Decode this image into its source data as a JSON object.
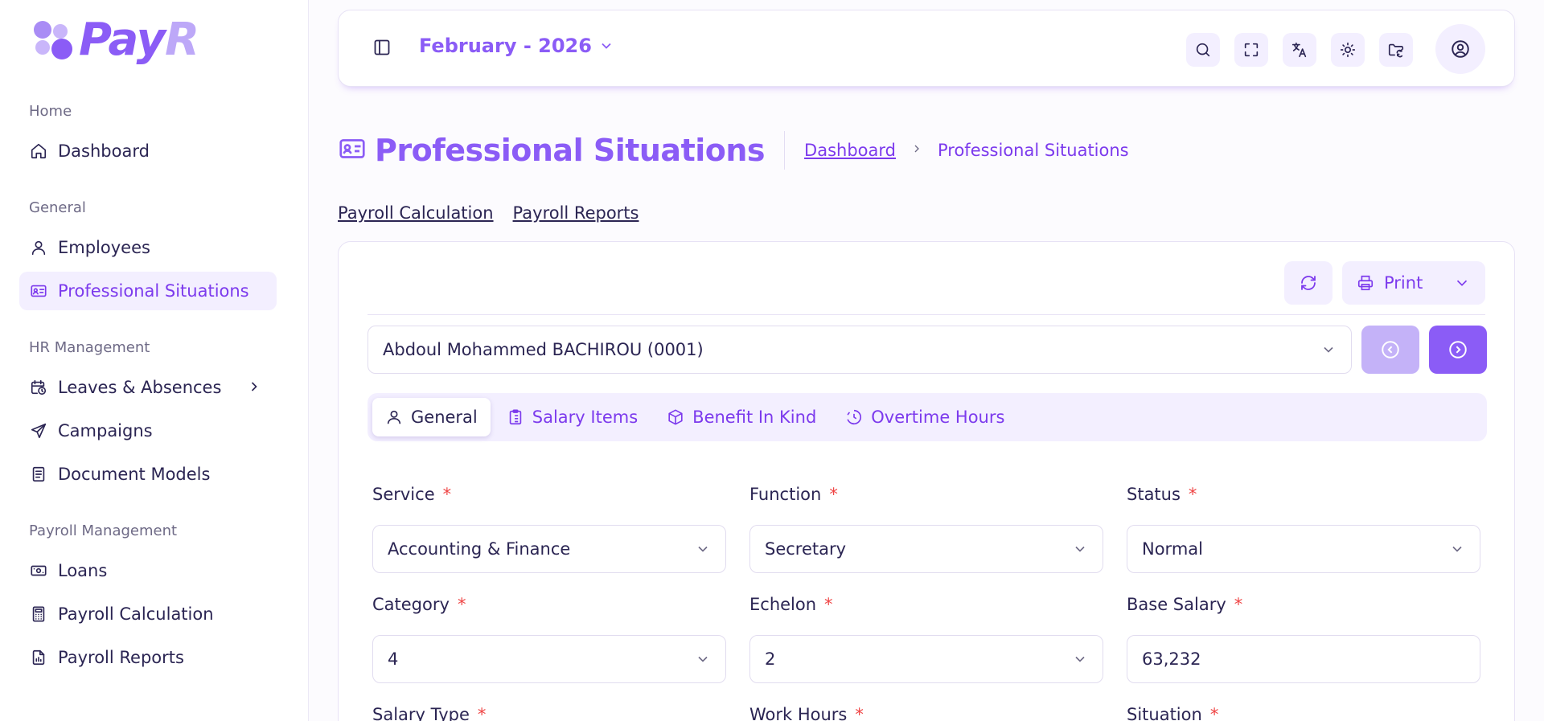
{
  "brand": {
    "name_main": "Pay",
    "name_accent": "R"
  },
  "sidebar": {
    "sections": [
      {
        "title": "Home",
        "items": [
          {
            "label": "Dashboard",
            "icon": "home-icon"
          }
        ]
      },
      {
        "title": "General",
        "items": [
          {
            "label": "Employees",
            "icon": "user-icon"
          },
          {
            "label": "Professional Situations",
            "icon": "id-card-icon",
            "active": true
          }
        ]
      },
      {
        "title": "HR Management",
        "items": [
          {
            "label": "Leaves & Absences",
            "icon": "calendar-clock-icon",
            "has_children": true
          },
          {
            "label": "Campaigns",
            "icon": "send-icon"
          },
          {
            "label": "Document Models",
            "icon": "document-icon"
          }
        ]
      },
      {
        "title": "Payroll Management",
        "items": [
          {
            "label": "Loans",
            "icon": "money-icon"
          },
          {
            "label": "Payroll Calculation",
            "icon": "calculator-icon"
          },
          {
            "label": "Payroll Reports",
            "icon": "report-icon"
          }
        ]
      }
    ]
  },
  "topbar": {
    "period": "February - 2026",
    "actions": [
      "search-icon",
      "fullscreen-icon",
      "translate-icon",
      "theme-sun-icon",
      "folder-sync-icon"
    ],
    "avatar_icon": "user-circle-icon"
  },
  "page": {
    "title": "Professional Situations",
    "breadcrumb": {
      "home": "Dashboard",
      "current": "Professional Situations"
    },
    "quick_links": [
      "Payroll Calculation",
      "Payroll Reports"
    ]
  },
  "card": {
    "print_label": "Print",
    "employee": "Abdoul Mohammed BACHIROU (0001)",
    "tabs": [
      {
        "label": "General",
        "icon": "user-icon",
        "active": true
      },
      {
        "label": "Salary Items",
        "icon": "clipboard-icon"
      },
      {
        "label": "Benefit In Kind",
        "icon": "box-icon"
      },
      {
        "label": "Overtime Hours",
        "icon": "clock-history-icon"
      }
    ],
    "fields": {
      "service": {
        "label": "Service",
        "value": "Accounting & Finance"
      },
      "function": {
        "label": "Function",
        "value": "Secretary"
      },
      "status": {
        "label": "Status",
        "value": "Normal"
      },
      "category": {
        "label": "Category",
        "value": "4"
      },
      "echelon": {
        "label": "Echelon",
        "value": "2"
      },
      "base_salary": {
        "label": "Base Salary",
        "value": "63,232"
      },
      "salary_type": {
        "label": "Salary Type"
      },
      "work_hours": {
        "label": "Work Hours"
      },
      "situation": {
        "label": "Situation"
      }
    },
    "required_mark": "*"
  },
  "colors": {
    "accent": "#8b5cf6",
    "accent_dark": "#7c3aed",
    "accent_soft": "#f3efff",
    "text": "#2b2553",
    "required": "#ef4444"
  }
}
